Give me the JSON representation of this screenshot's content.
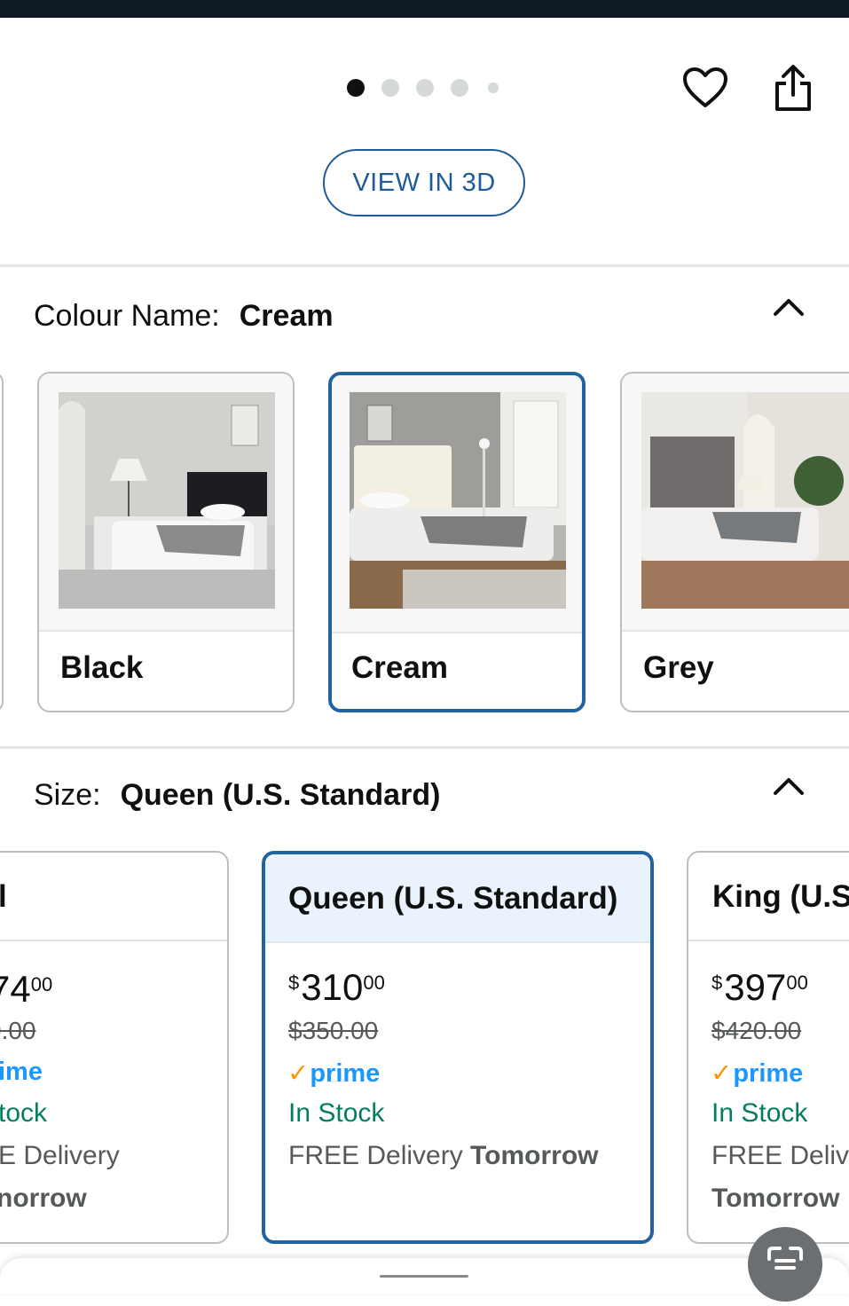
{
  "carousel": {
    "dot_count": 5,
    "active_index": 0,
    "view_3d_label": "VIEW IN 3D",
    "wishlist_icon": "heart-icon",
    "share_icon": "share-icon"
  },
  "colour": {
    "label": "Colour Name:",
    "selected": "Cream",
    "options": [
      {
        "label": "Black",
        "selected": false
      },
      {
        "label": "Cream",
        "selected": true
      },
      {
        "label": "Grey",
        "selected": false
      }
    ]
  },
  "size": {
    "label": "Size:",
    "selected": "Queen (U.S. Standard)",
    "options": [
      {
        "title": "l",
        "price_whole": "74",
        "price_fraction": "00",
        "was_price": "0.00",
        "prime": "ime",
        "stock": "tock",
        "delivery_line1": "E Delivery",
        "delivery_line2": "norrow",
        "selected": false
      },
      {
        "title": "Queen (U.S. Standard)",
        "currency": "$",
        "price_whole": "310",
        "price_fraction": "00",
        "was_price": "$350.00",
        "prime": "prime",
        "stock": "In Stock",
        "delivery_prefix": "FREE Delivery",
        "delivery_day": "Tomorrow",
        "selected": true
      },
      {
        "title": "King (U.S",
        "currency": "$",
        "price_whole": "397",
        "price_fraction": "00",
        "was_price": "$420.00",
        "prime": "prime",
        "stock": "In Stock",
        "delivery_prefix": "FREE Delive",
        "delivery_day": "Tomorrow",
        "selected": false
      }
    ]
  },
  "colors": {
    "accent": "#2162a1",
    "stock": "#067d62",
    "prime_blue": "#1a98ff",
    "prime_check": "#ff9900"
  }
}
